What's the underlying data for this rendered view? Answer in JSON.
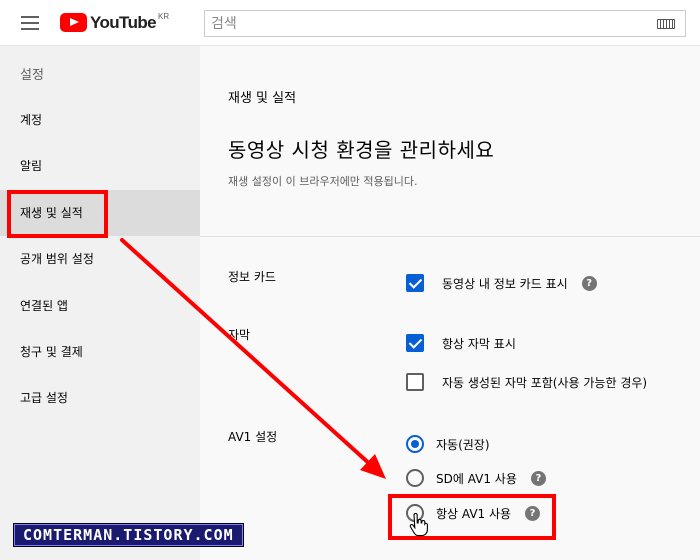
{
  "header": {
    "logo_text": "YouTube",
    "logo_region": "KR",
    "search_placeholder": "검색"
  },
  "sidebar": {
    "title": "설정",
    "items": [
      {
        "label": "계정"
      },
      {
        "label": "알림"
      },
      {
        "label": "재생 및 실적"
      },
      {
        "label": "공개 범위 설정"
      },
      {
        "label": "연결된 앱"
      },
      {
        "label": "청구 및 결제"
      },
      {
        "label": "고급 설정"
      }
    ]
  },
  "main": {
    "section_crumb": "재생 및 실적",
    "title": "동영상 시청 환경을 관리하세요",
    "subtitle": "재생 설정이 이 브라우저에만 적용됩니다.",
    "info_cards": {
      "label": "정보 카드",
      "option": "동영상 내 정보 카드 표시",
      "checked": true
    },
    "captions": {
      "label": "자막",
      "options": [
        {
          "label": "항상 자막 표시",
          "checked": true
        },
        {
          "label": "자동 생성된 자막 포함(사용 가능한 경우)",
          "checked": false
        }
      ]
    },
    "av1": {
      "label": "AV1 설정",
      "options": [
        {
          "label": "자동(권장)",
          "selected": true
        },
        {
          "label": "SD에 AV1 사용",
          "selected": false
        },
        {
          "label": "항상 AV1 사용",
          "selected": false
        }
      ]
    },
    "help_glyph": "?"
  },
  "annotations": {
    "highlight_color": "#ff0000",
    "watermark": "COMTERMAN.TISTORY.COM"
  },
  "colors": {
    "accent": "#065fd4",
    "brand": "#ff0000",
    "sidebar_bg": "#f1f1f1",
    "active_bg": "#dcdcdc"
  }
}
